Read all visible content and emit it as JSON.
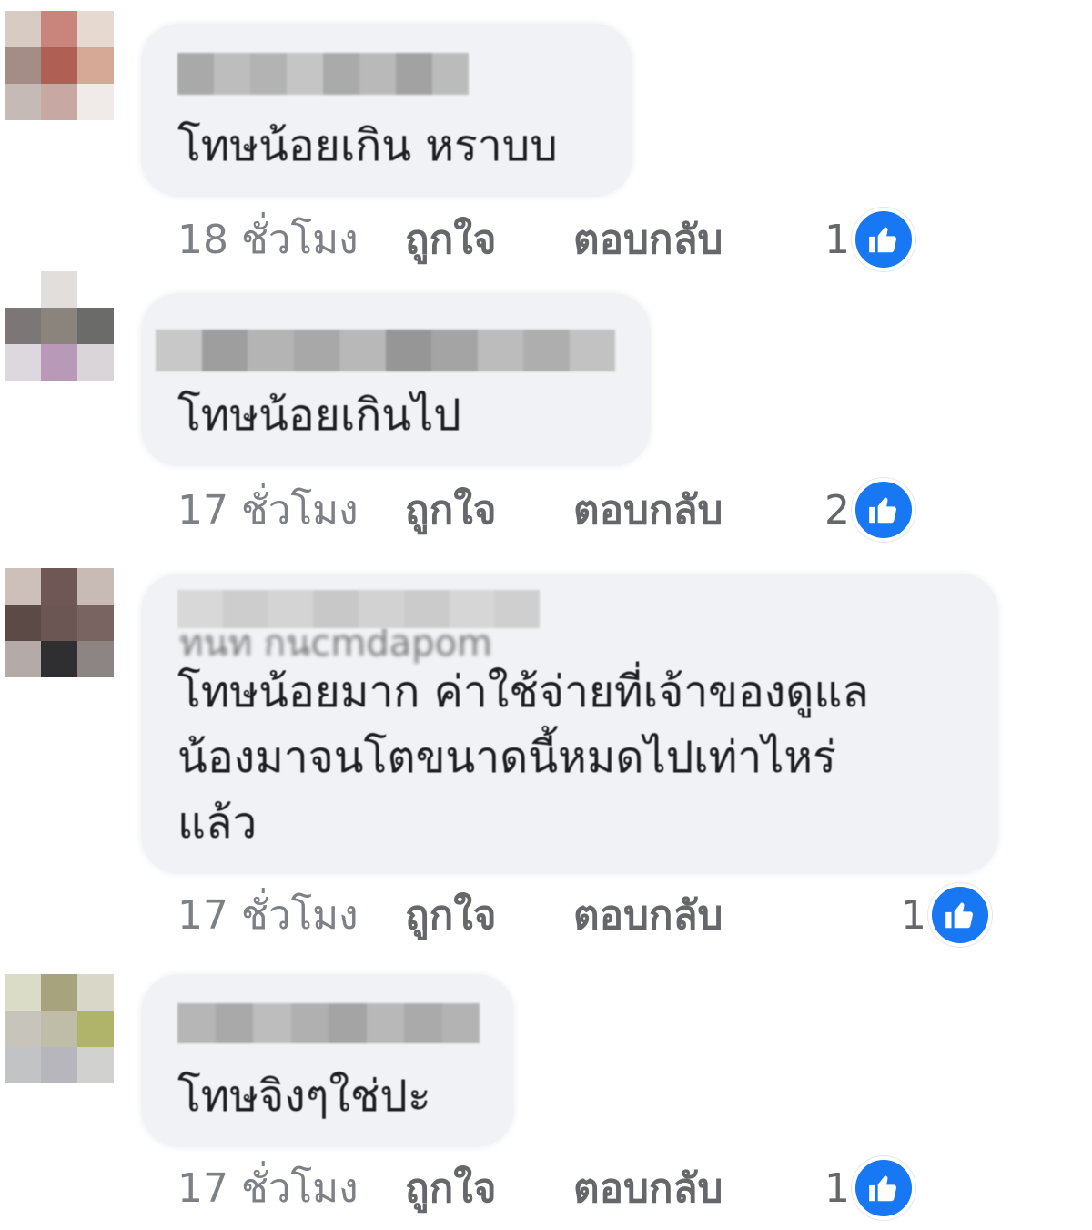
{
  "comments": [
    {
      "author": "",
      "text": "โทษน้อยเกิน หราบบ",
      "time": "18 ชั่วโมง",
      "like_label": "ถูกใจ",
      "reply_label": "ตอบกลับ",
      "reaction_count": "1",
      "avatar_colors": [
        "#d7cbc4",
        "#c9857c",
        "#e6d9d0",
        "#a48c87",
        "#b05f55",
        "#d6a996",
        "#c5bab6",
        "#c7a8a3",
        "#f0ebe8"
      ],
      "name_blur_colors": [
        "#a9a9a9",
        "#bdbdbd",
        "#b3b3b3",
        "#c5c5c5",
        "#aaaaaa",
        "#b9b9b9",
        "#a2a2a2",
        "#bbbbbb"
      ]
    },
    {
      "author": "",
      "text": "โทษน้อยเกินไป",
      "time": "17 ชั่วโมง",
      "like_label": "ถูกใจ",
      "reply_label": "ตอบกลับ",
      "reaction_count": "2",
      "avatar_colors": [
        "#ffffff",
        "#e2dedb",
        "#ffffff",
        "#7d7676",
        "#8b847c",
        "#6b6b69",
        "#dcd8dd",
        "#b89ab8",
        "#d9d5d9"
      ],
      "name_blur_colors": [
        "#c8c8c8",
        "#9e9e9e",
        "#b4b4b4",
        "#a8a8a8",
        "#b8b8b8",
        "#969696",
        "#a4a4a4",
        "#bcbcbc",
        "#aeaeae",
        "#c2c2c2"
      ]
    },
    {
      "author": "",
      "author_fragment": "ทนท กนcmdapom",
      "text": "โทษน้อยมาก ค่าใช้จ่ายที่เจ้าของดูแล\nน้องมาจนโตขนาดนี้หมดไปเท่าไหร่\nแล้ว",
      "time": "17 ชั่วโมง",
      "like_label": "ถูกใจ",
      "reply_label": "ตอบกลับ",
      "reaction_count": "1",
      "avatar_colors": [
        "#cdbfba",
        "#6e5754",
        "#c8bbb6",
        "#5c4a47",
        "#6b5654",
        "#7a6461",
        "#b4aaa8",
        "#2f2e30",
        "#8d8584"
      ],
      "name_blur_colors": [
        "#d8d8d8",
        "#cdcdcd",
        "#d4d4d4",
        "#c8c8c8",
        "#d2d2d2",
        "#cbcbcb",
        "#d6d6d6",
        "#cfcfcf"
      ]
    },
    {
      "author": "",
      "text": "โทษจิงๆใช่ปะ",
      "time": "17 ชั่วโมง",
      "like_label": "ถูกใจ",
      "reply_label": "ตอบกลับ",
      "reaction_count": "1",
      "avatar_colors": [
        "#dbdcc8",
        "#a7a37c",
        "#d9d7c8",
        "#c7c4bb",
        "#bfbca8",
        "#b0b46a",
        "#c1c3c4",
        "#b8b6bd",
        "#d1d2cf"
      ],
      "name_blur_colors": [
        "#b6b6b6",
        "#a9a9a9",
        "#bdbdbd",
        "#b0b0b0",
        "#a4a4a4",
        "#b8b8b8",
        "#aaaaaa",
        "#b3b3b3"
      ]
    }
  ],
  "colors": {
    "bubble": "#f0f2f5",
    "like_blue": "#1877f2",
    "meta_text": "#65676b"
  },
  "icons": {
    "reaction": "thumbs-up-icon"
  }
}
